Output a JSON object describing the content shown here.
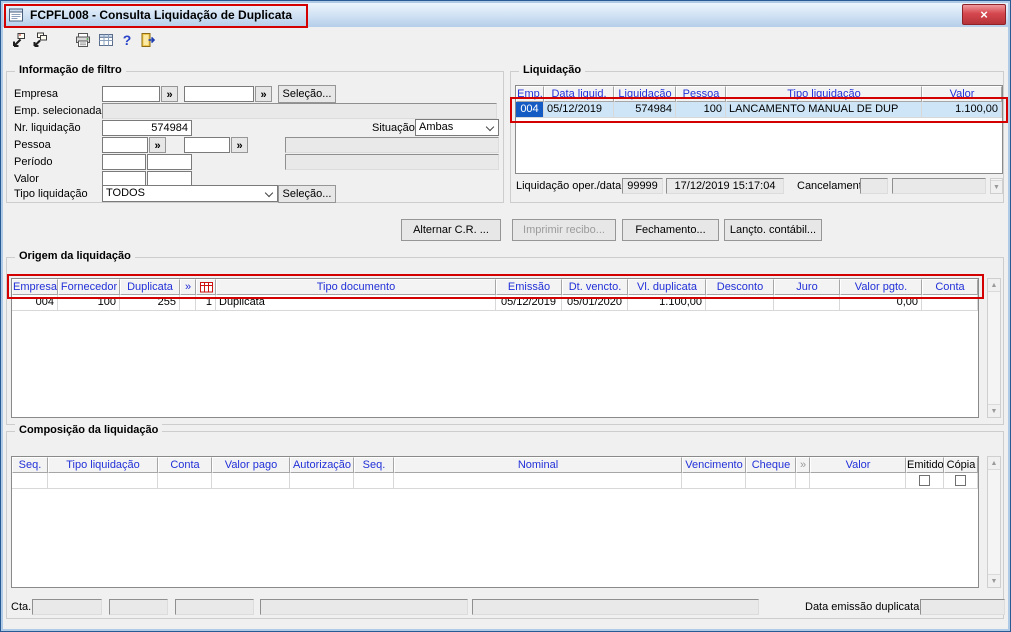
{
  "window": {
    "title": "FCPFL008 - Consulta Liquidação de Duplicata",
    "close_glyph": "×"
  },
  "glyphs": {
    "lookup": "»",
    "scroll_up": "▲",
    "scroll_down": "▼"
  },
  "toolbar": {
    "icons": [
      "goto-record-icon",
      "goto-records-icon",
      "print-icon",
      "grid-icon",
      "help-icon",
      "exit-icon"
    ]
  },
  "filtro": {
    "title": "Informação de filtro",
    "empresa_label": "Empresa",
    "emp_selecionada_label": "Emp. selecionada",
    "nr_liquidacao_label": "Nr. liquidação",
    "nr_liquidacao_value": "574984",
    "situacao_label": "Situação",
    "situacao_value": "Ambas",
    "pessoa_label": "Pessoa",
    "periodo_label": "Período",
    "valor_label": "Valor",
    "tipo_liquidacao_label": "Tipo liquidação",
    "tipo_liquidacao_value": "TODOS",
    "selecao_button": "Seleção...",
    "alternar_button": "Alternar C.R. ..."
  },
  "liquidacao": {
    "title": "Liquidação",
    "columns": [
      "Emp.",
      "Data liquid.",
      "Liquidação",
      "Pessoa",
      "Tipo liquidação",
      "Valor"
    ],
    "row": [
      "004",
      "05/12/2019",
      "574984",
      "100",
      "LANCAMENTO MANUAL DE DUP",
      "1.100,00"
    ],
    "oper_label": "Liquidação oper./data",
    "oper_value": "99999",
    "oper_datetime": "17/12/2019 15:17:04",
    "cancelamento_label": "Cancelamento",
    "imprimir_button": "Imprimir recibo...",
    "fechamento_button": "Fechamento...",
    "lancto_button": "Lançto. contábil..."
  },
  "origem": {
    "title": "Origem da liquidação",
    "columns": [
      "Empresa",
      "Fornecedor",
      "Duplicata",
      "»",
      "",
      "Tipo documento",
      "Emissão",
      "Dt. vencto.",
      "Vl. duplicata",
      "Desconto",
      "Juro",
      "Valor  pgto.",
      "Conta"
    ],
    "row": [
      "004",
      "100",
      "255",
      "",
      "1",
      "Duplicata",
      "05/12/2019",
      "05/01/2020",
      "1.100,00",
      "",
      "",
      "0,00",
      ""
    ]
  },
  "composicao": {
    "title": "Composição da liquidação",
    "columns": [
      "Seq.",
      "Tipo liquidação",
      "Conta",
      "Valor pago",
      "Autorização",
      "Seq.",
      "Nominal",
      "Vencimento",
      "Cheque",
      "»",
      "Valor",
      "Emitido",
      "Cópia"
    ],
    "cta_label": "Cta.",
    "data_emissao_label": "Data emissão duplicata"
  }
}
